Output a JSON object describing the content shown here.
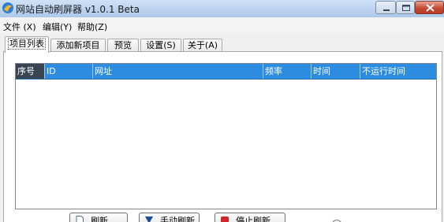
{
  "window": {
    "title": "网站自动刷屏器 v1.0.1 Beta"
  },
  "menu": {
    "items": [
      {
        "label": "文件 (X)"
      },
      {
        "label": "编辑(Y)"
      },
      {
        "label": "帮助(Z)"
      }
    ]
  },
  "tabs": [
    {
      "label": "项目列表",
      "active": true
    },
    {
      "label": "添加新项目",
      "active": false
    },
    {
      "label": "预览",
      "active": false
    },
    {
      "label": "设置(S)",
      "active": false
    },
    {
      "label": "关于(A)",
      "active": false
    }
  ],
  "table": {
    "columns": [
      "序号",
      "ID",
      "网址",
      "频率",
      "时间",
      "不运行时间"
    ],
    "rows": []
  },
  "buttons": {
    "refresh": "刷新",
    "manual_refresh": "手动刷新",
    "stop_refresh": "停止刷新"
  },
  "colors": {
    "header_bg": "#2b8ce0",
    "first_header_bg": "#3a4450",
    "close_button": "#c94a33"
  },
  "icons": {
    "app": "app-logo-icon",
    "minimize": "minimize-icon",
    "maximize": "maximize-icon",
    "close": "close-icon",
    "refresh": "refresh-doc-icon",
    "manual_refresh": "manual-refresh-icon",
    "stop_refresh": "stop-icon"
  }
}
